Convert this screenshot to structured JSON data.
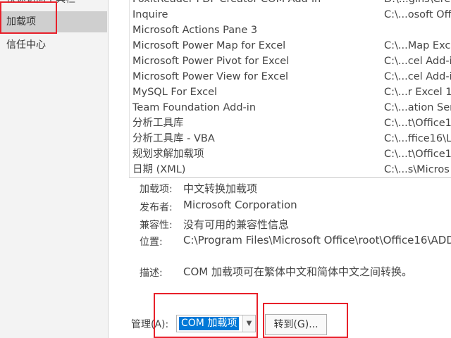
{
  "nav": {
    "items": [
      {
        "label": "快速访问工具栏"
      },
      {
        "label": "加载项"
      },
      {
        "label": "信任中心"
      }
    ]
  },
  "addins": {
    "rows": [
      {
        "name": "FoxitReader PDF Creator COM Add-in",
        "location": "D:\\...gins\\Cre"
      },
      {
        "name": "Inquire",
        "location": "C:\\...osoft Off"
      },
      {
        "name": "Microsoft Actions Pane 3",
        "location": ""
      },
      {
        "name": "Microsoft Power Map for Excel",
        "location": "C:\\...Map Exc"
      },
      {
        "name": "Microsoft Power Pivot for Excel",
        "location": "C:\\...cel Add-i"
      },
      {
        "name": "Microsoft Power View for Excel",
        "location": "C:\\...cel Add-i"
      },
      {
        "name": "MySQL For Excel",
        "location": "C:\\...r Excel 1."
      },
      {
        "name": "Team Foundation Add-in",
        "location": "C:\\...ation Ser"
      },
      {
        "name": "分析工具库",
        "location": "C:\\...t\\Office1"
      },
      {
        "name": "分析工具库 - VBA",
        "location": "C:\\...ffice16\\L"
      },
      {
        "name": "规划求解加载项",
        "location": "C:\\...t\\Office1"
      },
      {
        "name": "日期 (XML)",
        "location": "C:\\...s\\Micros"
      }
    ]
  },
  "details": {
    "addin_label": "加载项:",
    "addin_value": "中文转换加载项",
    "publisher_label": "发布者:",
    "publisher_value": "Microsoft Corporation",
    "compat_label": "兼容性:",
    "compat_value": "没有可用的兼容性信息",
    "location_label": "位置:",
    "location_value": "C:\\Program Files\\Microsoft Office\\root\\Office16\\ADD",
    "desc_label": "描述:",
    "desc_value": "COM 加载项可在繁体中文和简体中文之间转换。"
  },
  "manage": {
    "label": "管理(A):",
    "selected": "COM 加载项",
    "goto_label": "转到(G)..."
  },
  "colors": {
    "highlight": "#e8202a",
    "selection": "#0078d7"
  }
}
